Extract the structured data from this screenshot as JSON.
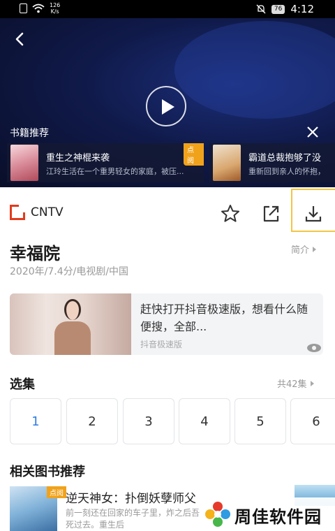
{
  "status_bar": {
    "speed": "126\nK/s",
    "battery": "76",
    "time": "4:12"
  },
  "video": {
    "book_rec_title": "书籍推荐",
    "cards": [
      {
        "name": "重生之神棍来袭",
        "desc": "江玲生活在一个重男轻女的家庭，被压...",
        "badge": "点阅"
      },
      {
        "name": "霸道总裁抱够了没",
        "desc": "重新回到亲人的怀抱，"
      }
    ]
  },
  "brand": {
    "name": "CNTV"
  },
  "show": {
    "title": "幸福院",
    "intro_label": "简介",
    "meta": "2020年/7.4分/电视剧/中国"
  },
  "ad": {
    "text": "赶快打开抖音极速版，想看什么随便搜，全部...",
    "source": "抖音极速版"
  },
  "episodes": {
    "title": "选集",
    "count": "共42集",
    "items": [
      "1",
      "2",
      "3",
      "4",
      "5",
      "6"
    ],
    "active": "1"
  },
  "related": {
    "title": "相关图书推荐",
    "items": [
      {
        "badge": "点阅",
        "name": "逆天神女：扑倒妖孽师父",
        "desc": "前一刻还在回家的车子里，炸之后吾死过去。重生后"
      }
    ]
  },
  "watermark": {
    "text": "周佳软件园"
  },
  "colors": {
    "accent_blue": "#2f7de1",
    "badge_orange": "#f1a21b",
    "brand_red": "#e23b1d",
    "highlight_yellow": "#f4c542"
  }
}
